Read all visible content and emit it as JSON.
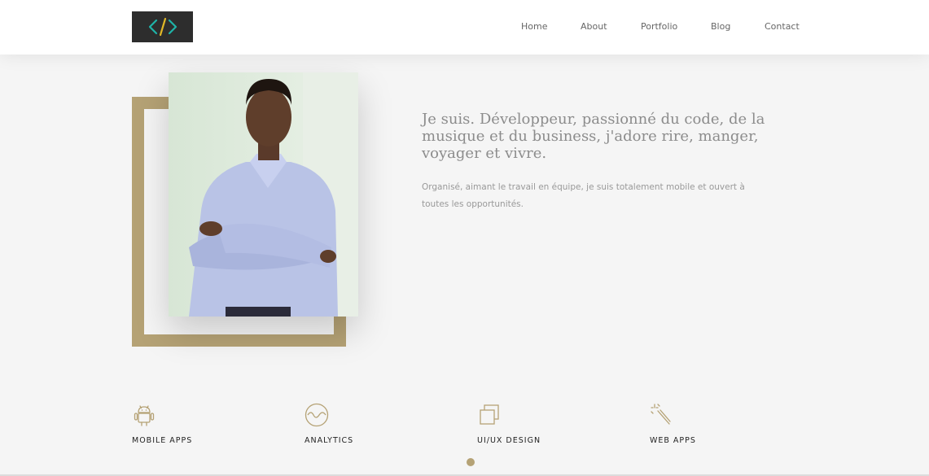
{
  "nav": {
    "items": [
      {
        "label": "Home"
      },
      {
        "label": "About"
      },
      {
        "label": "Portfolio"
      },
      {
        "label": "Blog"
      },
      {
        "label": "Contact"
      }
    ]
  },
  "hero": {
    "headline": "Je suis. Développeur, passionné du code, de la musique et du business, j'adore rire, manger, voyager et vivre.",
    "description": "Organisé, aimant le travail en équipe, je suis totalement mobile et ouvert à toutes les opportunités."
  },
  "services": [
    {
      "label": "MOBILE APPS",
      "icon": "android-icon"
    },
    {
      "label": "ANALYTICS",
      "icon": "wave-icon"
    },
    {
      "label": "UI/UX DESIGN",
      "icon": "layers-icon"
    },
    {
      "label": "WEB APPS",
      "icon": "magic-wand-icon"
    }
  ],
  "colors": {
    "accent": "#b5a275",
    "logo_bg": "#2d2d2d",
    "logo_teal": "#1fb3a8",
    "logo_yellow": "#e0b727"
  }
}
